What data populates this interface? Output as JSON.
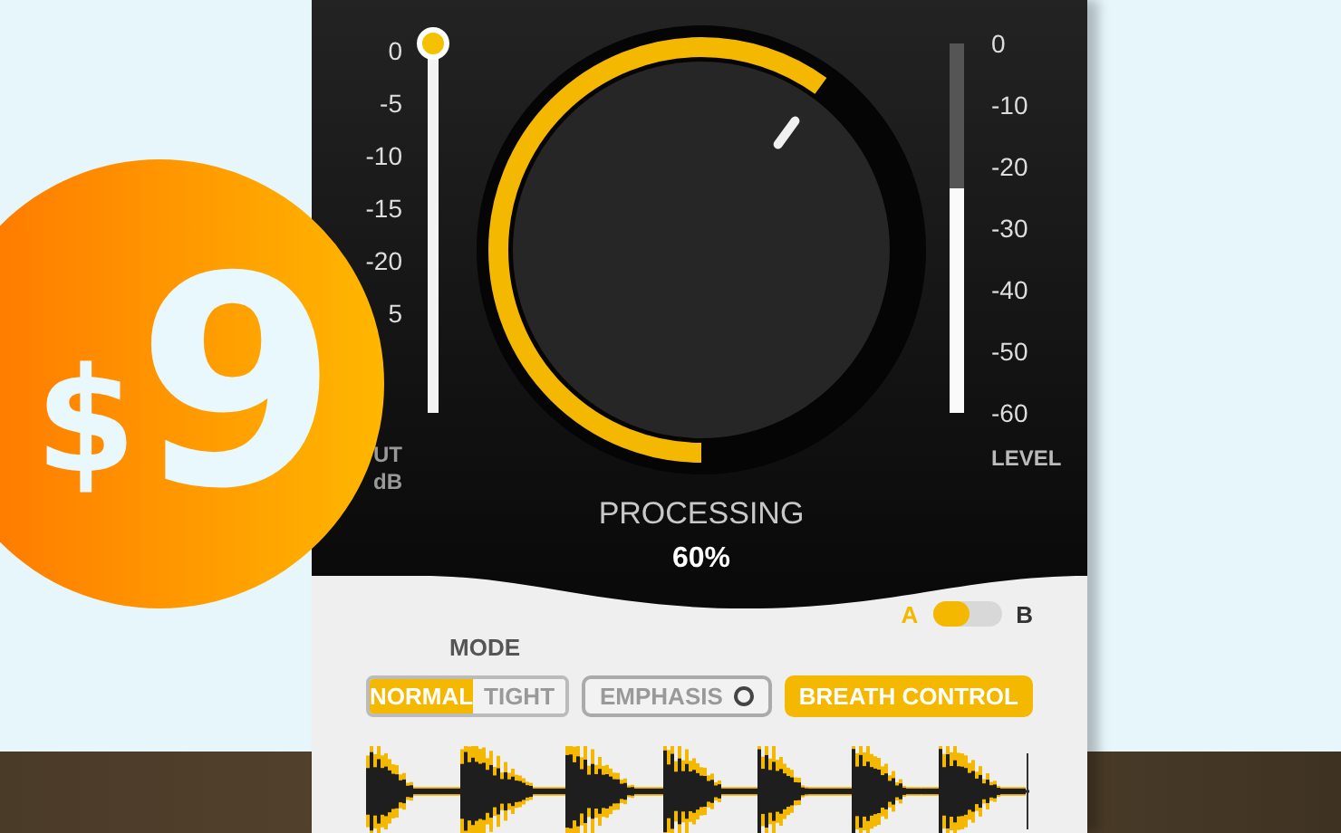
{
  "input_scale": {
    "labels": [
      "0",
      "-5",
      "-10",
      "-15",
      "-20",
      "5"
    ],
    "caption": [
      "UT",
      "dB"
    ]
  },
  "input_slider": {
    "level": 1
  },
  "knob": {
    "level": 0.6,
    "label": "PROCESSING",
    "value": "60%"
  },
  "level_meter": {
    "level": 0.61,
    "labels": [
      "0",
      "-10",
      "-20",
      "-30",
      "-40",
      "-50",
      "-60"
    ],
    "caption": "LEVEL"
  },
  "ab_switch": [
    {
      "label": "A",
      "selected": true
    },
    {
      "label": "B",
      "selected": false
    }
  ],
  "mode": {
    "label": "MODE",
    "options": [
      {
        "label": "NORMAL",
        "selected": true
      },
      {
        "label": "TIGHT",
        "selected": false
      }
    ]
  },
  "emphasis": {
    "label": "EMPHASIS",
    "on": false
  },
  "breath_control": {
    "label": "BREATH CONTROL",
    "on": true
  },
  "badge": {
    "currency": "$",
    "price": "9"
  }
}
